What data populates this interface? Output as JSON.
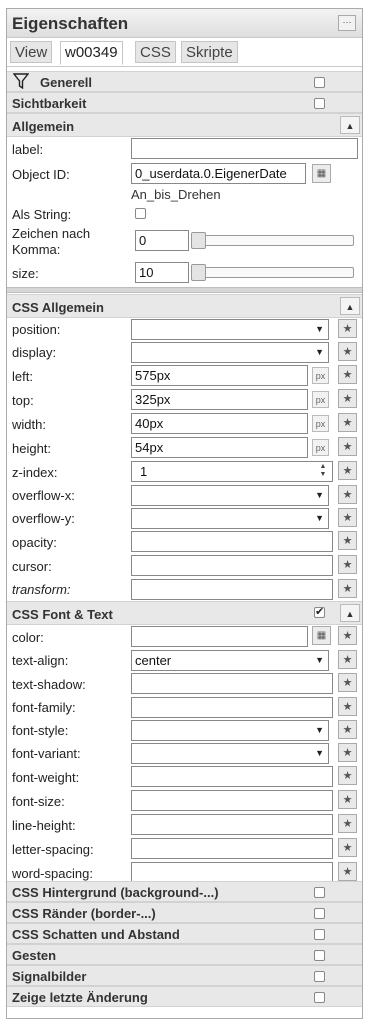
{
  "panel": {
    "title": "Eigenschaften",
    "menu_icon": "dots-icon"
  },
  "tabs": [
    {
      "label": "View",
      "active": false
    },
    {
      "label": "w00349",
      "active": true
    },
    {
      "label": "CSS",
      "active": false
    },
    {
      "label": "Skripte",
      "active": false
    }
  ],
  "groups": {
    "generell": "Generell",
    "sichtbarkeit": "Sichtbarkeit",
    "allgemein": "Allgemein",
    "css_allgemein": "CSS Allgemein",
    "css_font": "CSS Font & Text",
    "css_hintergrund": "CSS Hintergrund (background-...)",
    "css_raender": "CSS Ränder (border-...)",
    "css_schatten": "CSS Schatten und Abstand",
    "gesten": "Gesten",
    "signalbilder": "Signalbilder",
    "letzte_aenderung": "Zeige letzte Änderung"
  },
  "allgemein": {
    "label_lbl": "label:",
    "label_value": "",
    "oid_lbl": "Object ID:",
    "oid_value": "0_userdata.0.EigenerDate",
    "oid_sub": "An_bis_Drehen",
    "als_string_lbl": "Als String:",
    "als_string_checked": false,
    "zeichen_lbl_1": "Zeichen nach",
    "zeichen_lbl_2": "Komma:",
    "zeichen_value": "0",
    "size_lbl": "size:",
    "size_value": "10"
  },
  "css_allgemein": {
    "position_lbl": "position:",
    "position_value": "",
    "display_lbl": "display:",
    "display_value": "",
    "left_lbl": "left:",
    "left_value": "575px",
    "top_lbl": "top:",
    "top_value": "325px",
    "width_lbl": "width:",
    "width_value": "40px",
    "height_lbl": "height:",
    "height_value": "54px",
    "zindex_lbl": "z-index:",
    "zindex_value": "1",
    "overflowx_lbl": "overflow-x:",
    "overflowx_value": "",
    "overflowy_lbl": "overflow-y:",
    "overflowy_value": "",
    "opacity_lbl": "opacity:",
    "opacity_value": "",
    "cursor_lbl": "cursor:",
    "cursor_value": "",
    "transform_lbl": "transform:",
    "transform_value": "",
    "unit": "px"
  },
  "css_font": {
    "enabled": true,
    "color_lbl": "color:",
    "color_value": "",
    "textalign_lbl": "text-align:",
    "textalign_value": "center",
    "textshadow_lbl": "text-shadow:",
    "textshadow_value": "",
    "fontfamily_lbl": "font-family:",
    "fontfamily_value": "",
    "fontstyle_lbl": "font-style:",
    "fontstyle_value": "",
    "fontvariant_lbl": "font-variant:",
    "fontvariant_value": "",
    "fontweight_lbl": "font-weight:",
    "fontweight_value": "",
    "fontsize_lbl": "font-size:",
    "fontsize_value": "",
    "lineheight_lbl": "line-height:",
    "lineheight_value": "",
    "letterspacing_lbl": "letter-spacing:",
    "letterspacing_value": "",
    "wordspacing_lbl": "word-spacing:",
    "wordspacing_value": ""
  },
  "icons": {
    "star": "star-icon",
    "filter": "filter-icon",
    "caret_up": "caret-up-icon",
    "select": "dots-icon"
  }
}
